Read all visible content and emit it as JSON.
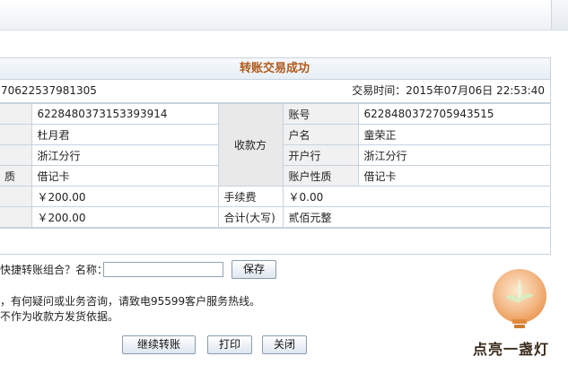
{
  "panel": {
    "title": "转账交易成功",
    "serial_fragment": "70622537981305",
    "time_label": "交易时间：",
    "time_value": "2015年07月06日 22:53:40"
  },
  "rows": [
    {
      "label_left": "",
      "value_left": "6228480373153393914",
      "label_right": "账号",
      "value_right": "6228480372705943515"
    },
    {
      "label_left": "",
      "value_left": "杜月君",
      "label_right": "户名",
      "value_right": "童荣正"
    },
    {
      "label_left": "",
      "value_left": "浙江分行",
      "label_right": "开户行",
      "value_right": "浙江分行"
    },
    {
      "label_left": "质",
      "value_left": "借记卡",
      "label_right": "账户性质",
      "value_right": "借记卡"
    }
  ],
  "payee_label": "收款方",
  "amounts": [
    {
      "value_left": "￥200.00",
      "label_right": "手续费",
      "value_right": "￥0.00"
    },
    {
      "value_left": "￥200.00",
      "label_right": "合计(大写)",
      "value_right": "贰佰元整"
    }
  ],
  "combo": {
    "label": "快捷转账组合？名称：",
    "input_value": "",
    "save_label": "保存"
  },
  "notice": {
    "line1": "，有何疑问或业务咨询，请致电95599客户服务热线。",
    "line2": "不作为收款方发货依据。"
  },
  "actions": {
    "continue_label": "继续转账",
    "print_label": "打印",
    "close_label": "关闭"
  },
  "watermark": {
    "text": "点亮一盏灯"
  }
}
